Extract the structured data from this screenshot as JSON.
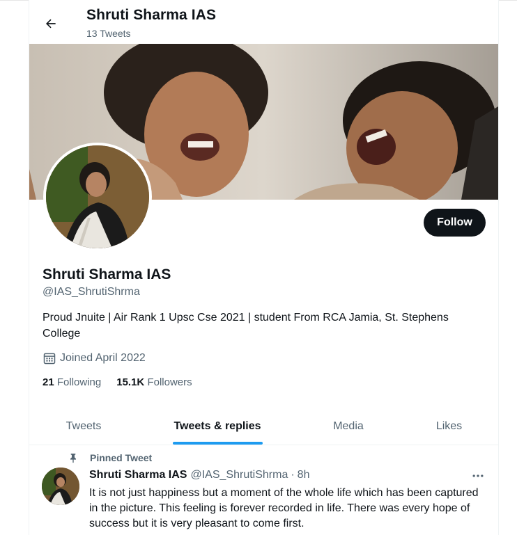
{
  "header": {
    "name": "Shruti Sharma IAS",
    "tweet_count": "13 Tweets"
  },
  "profile": {
    "name": "Shruti Sharma IAS",
    "handle": "@IAS_ShrutiShrma",
    "bio": "Proud Jnuite | Air Rank 1 Upsc Cse 2021 | student From RCA Jamia, St. Stephens College",
    "joined": "Joined April 2022",
    "follow_label": "Follow",
    "following_count": "21",
    "following_label": "Following",
    "followers_count": "15.1K",
    "followers_label": "Followers"
  },
  "tabs": [
    {
      "label": "Tweets",
      "active": false
    },
    {
      "label": "Tweets & replies",
      "active": true
    },
    {
      "label": "Media",
      "active": false
    },
    {
      "label": "Likes",
      "active": false
    }
  ],
  "pinned_tweet": {
    "pinned_label": "Pinned Tweet",
    "author_name": "Shruti Sharma IAS",
    "author_handle": "@IAS_ShrutiShrma",
    "separator": "·",
    "time": "8h",
    "text": "It is not just happiness but a moment of the whole life which has been captured in the picture. This feeling is forever recorded in life. There was every hope of success but it is very pleasant to come first."
  },
  "icons": {
    "back": "arrow-left-icon",
    "calendar": "calendar-icon",
    "pin": "pin-icon",
    "more": "more-horizontal-icon"
  },
  "colors": {
    "accent": "#1d9bf0",
    "text_primary": "#0f1419",
    "text_secondary": "#536471",
    "follow_button_bg": "#0f1419"
  }
}
